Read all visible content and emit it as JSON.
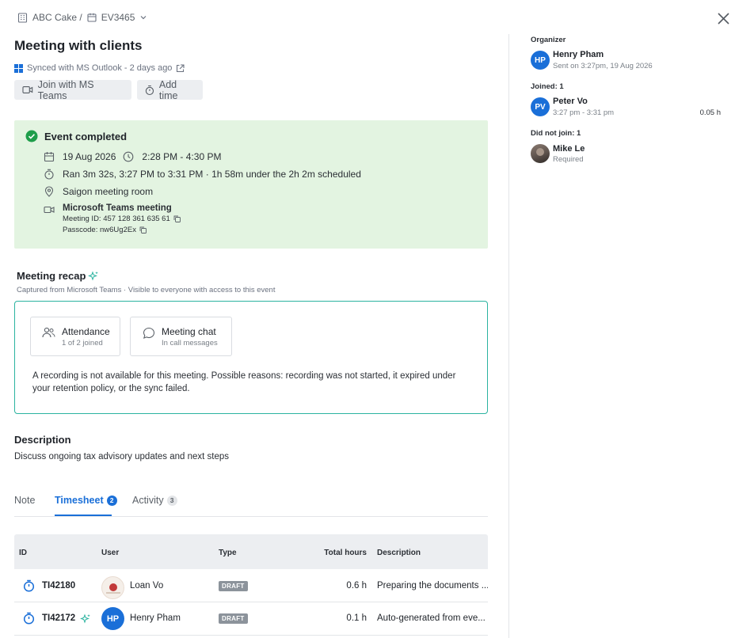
{
  "breadcrumb": {
    "company": "ABC Cake /",
    "event_id": "EV3465"
  },
  "title": "Meeting with clients",
  "sync": {
    "text": "Synced with MS Outlook - 2 days ago"
  },
  "buttons": {
    "join": "Join with MS Teams",
    "add_time": "Add time"
  },
  "event": {
    "status": "Event completed",
    "date": "19 Aug 2026",
    "time": "2:28 PM - 4:30 PM",
    "ran": "Ran 3m 32s, 3:27 PM to 3:31 PM · 1h 58m under the 2h 2m scheduled",
    "location": "Saigon meeting room",
    "teams_title": "Microsoft Teams meeting",
    "meeting_id": "Meeting ID: 457 128 361 635 61",
    "passcode": "Passcode: nw6Ug2Ex",
    "status_color": "#1e9e4a",
    "bg_color": "#e3f4e1"
  },
  "recap": {
    "title": "Meeting recap",
    "subtitle": "Captured from Microsoft Teams · Visible to everyone with access to this event",
    "border_color": "#2bb3a0",
    "cards": [
      {
        "title": "Attendance",
        "sub": "1 of 2 joined",
        "icon": "people-icon"
      },
      {
        "title": "Meeting chat",
        "sub": "In call messages",
        "icon": "chat-bubble-icon"
      }
    ],
    "notice": "A recording is not available for this meeting. Possible reasons: recording was not started, it expired under your retention policy, or the sync failed."
  },
  "description": {
    "heading": "Description",
    "text": "Discuss ongoing tax advisory updates and next steps"
  },
  "tabs": [
    {
      "label": "Note",
      "badge": ""
    },
    {
      "label": "Timesheet",
      "badge": "2",
      "active": true
    },
    {
      "label": "Activity",
      "badge": "3"
    }
  ],
  "table": {
    "headers": [
      "ID",
      "User",
      "Type",
      "Total hours",
      "Description"
    ],
    "rows": [
      {
        "id": "TI42180",
        "user": "Loan Vo",
        "type": "DRAFT",
        "hours": "0.6 h",
        "desc": "Preparing the documents ..."
      },
      {
        "id": "TI42172",
        "user": "Henry Pham",
        "initials": "HP",
        "type": "DRAFT",
        "hours": "0.1 h",
        "desc": "Auto-generated from eve..."
      }
    ]
  },
  "sidebar": {
    "organizer_label": "Organizer",
    "organizer": {
      "initials": "HP",
      "name": "Henry Pham",
      "sub": "Sent on 3:27pm, 19 Aug 2026"
    },
    "joined_label": "Joined: 1",
    "joined": {
      "initials": "PV",
      "name": "Peter Vo",
      "sub": "3:27 pm - 3:31 pm",
      "hours": "0.05 h"
    },
    "not_joined_label": "Did not join: 1",
    "not_joined": {
      "name": "Mike Le",
      "sub": "Required"
    }
  },
  "colors": {
    "accent": "#1a6fd8",
    "teal": "#2bb3a0"
  }
}
